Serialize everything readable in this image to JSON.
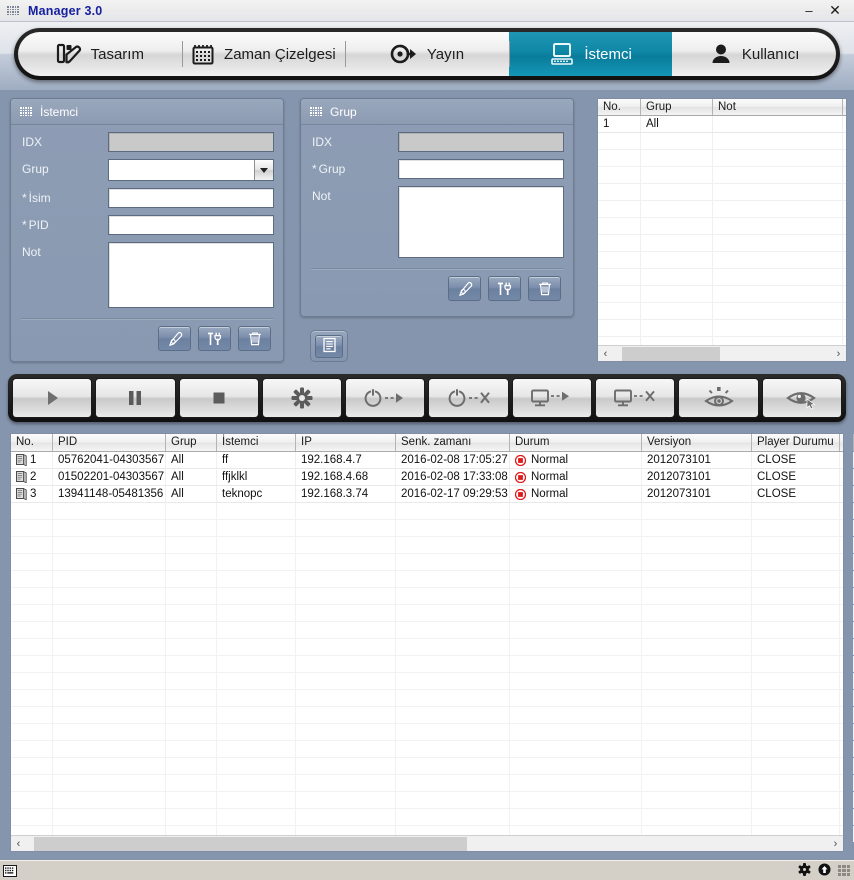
{
  "window": {
    "title": "Manager 3.0",
    "icon": "grid-icon",
    "minimize_label": "–",
    "close_label": "✕",
    "accent_active_tab": "#0f87a6",
    "panel_bg": "#8c9bb2",
    "status_dot_color": "#e01b1b"
  },
  "tabs": [
    {
      "label": "Tasarım",
      "icon": "design-icon",
      "active": false
    },
    {
      "label": "Zaman Çizelgesi",
      "icon": "calendar-icon",
      "active": false
    },
    {
      "label": "Yayın",
      "icon": "broadcast-icon",
      "active": false
    },
    {
      "label": "İstemci",
      "icon": "monitor-icon",
      "active": true
    },
    {
      "label": "Kullanıcı",
      "icon": "user-icon",
      "active": false
    }
  ],
  "client_panel": {
    "title": "İstemci",
    "icon": "grid-icon",
    "fields": [
      {
        "label": "IDX",
        "required": false,
        "type": "text-readonly",
        "value": ""
      },
      {
        "label": "Grup",
        "required": false,
        "type": "combo",
        "value": ""
      },
      {
        "label": "İsim",
        "required": true,
        "type": "text",
        "value": ""
      },
      {
        "label": "PID",
        "required": true,
        "type": "text",
        "value": ""
      },
      {
        "label": "Not",
        "required": false,
        "type": "textarea",
        "value": ""
      }
    ],
    "buttons": [
      {
        "name": "add-button",
        "icon": "pen-icon"
      },
      {
        "name": "edit-button",
        "icon": "tools-icon"
      },
      {
        "name": "delete-button",
        "icon": "trash-icon"
      }
    ]
  },
  "group_panel": {
    "title": "Grup",
    "icon": "grid-icon",
    "fields": [
      {
        "label": "IDX",
        "required": false,
        "type": "text-readonly",
        "value": ""
      },
      {
        "label": "Grup",
        "required": true,
        "type": "text",
        "value": ""
      },
      {
        "label": "Not",
        "required": false,
        "type": "textarea",
        "value": ""
      }
    ],
    "buttons": [
      {
        "name": "add-button",
        "icon": "pen-icon"
      },
      {
        "name": "edit-button",
        "icon": "tools-icon"
      },
      {
        "name": "delete-button",
        "icon": "trash-icon"
      }
    ],
    "detail_button": {
      "name": "list-detail-button",
      "icon": "list-icon"
    }
  },
  "group_grid": {
    "columns": [
      {
        "label": "No.",
        "width": 43
      },
      {
        "label": "Grup",
        "width": 72
      },
      {
        "label": "Not",
        "width": 130
      }
    ],
    "rows": [
      {
        "no": "1",
        "grup": "All",
        "not": ""
      }
    ],
    "empty_row_count": 13,
    "scrollbar": {
      "left_arrow": "‹",
      "right_arrow": "›",
      "thumb_start_pct": 4,
      "thumb_width_pct": 45
    }
  },
  "control_toolbar": [
    {
      "name": "play-button",
      "icon": "play-icon"
    },
    {
      "name": "pause-button",
      "icon": "pause-icon"
    },
    {
      "name": "stop-button",
      "icon": "stop-icon"
    },
    {
      "name": "settings-button",
      "icon": "gear-icon"
    },
    {
      "name": "power-on-button",
      "icon": "power-arrow-icon"
    },
    {
      "name": "power-off-button",
      "icon": "power-x-icon"
    },
    {
      "name": "screen-on-button",
      "icon": "monitor-arrow-icon"
    },
    {
      "name": "screen-off-button",
      "icon": "monitor-x-icon"
    },
    {
      "name": "preview-button",
      "icon": "eye-rays-icon"
    },
    {
      "name": "remote-preview-button",
      "icon": "eye-cursor-icon"
    }
  ],
  "main_table": {
    "columns": [
      {
        "label": "No.",
        "width": 42
      },
      {
        "label": "PID",
        "width": 113
      },
      {
        "label": "Grup",
        "width": 51
      },
      {
        "label": "İstemci",
        "width": 79
      },
      {
        "label": "IP",
        "width": 100
      },
      {
        "label": "Senk. zamanı",
        "width": 114
      },
      {
        "label": "Durum",
        "width": 132
      },
      {
        "label": "Versiyon",
        "width": 110
      },
      {
        "label": "Player Durumu",
        "width": 88
      },
      {
        "label": "",
        "width": 14
      }
    ],
    "rows": [
      {
        "icon": "monitor-row-icon",
        "no": "1",
        "pid": "05762041-04303567",
        "grup": "All",
        "istemci": "ff",
        "ip": "192.168.4.7",
        "senk": "2016-02-08 17:05:27",
        "durum": "Normal",
        "durum_icon": "red-stop-icon",
        "versiyon": "2012073101",
        "player": "CLOSE",
        "extra": ""
      },
      {
        "icon": "monitor-row-icon",
        "no": "2",
        "pid": "01502201-04303567",
        "grup": "All",
        "istemci": "ffjklkl",
        "ip": "192.168.4.68",
        "senk": "2016-02-08 17:33:08",
        "durum": "Normal",
        "durum_icon": "red-stop-icon",
        "versiyon": "2012073101",
        "player": "CLOSE",
        "extra": ""
      },
      {
        "icon": "monitor-row-icon",
        "no": "3",
        "pid": "13941148-05481356",
        "grup": "All",
        "istemci": "teknopc",
        "ip": "192.168.3.74",
        "senk": "2016-02-17 09:29:53",
        "durum": "Normal",
        "durum_icon": "red-stop-icon",
        "versiyon": "2012073101",
        "player": "CLOSE",
        "extra": ""
      }
    ],
    "empty_row_count": 20,
    "scrollbar": {
      "left_arrow": "‹",
      "right_arrow": "›",
      "thumb_start_pct": 1,
      "thumb_width_pct": 54
    }
  },
  "statusbar": {
    "left_icon": "keyboard-icon",
    "icons": [
      {
        "name": "gear-status-icon",
        "glyph": "gear"
      },
      {
        "name": "upload-status-icon",
        "glyph": "arrow-up"
      }
    ],
    "resize_grip": "resize-grip"
  }
}
